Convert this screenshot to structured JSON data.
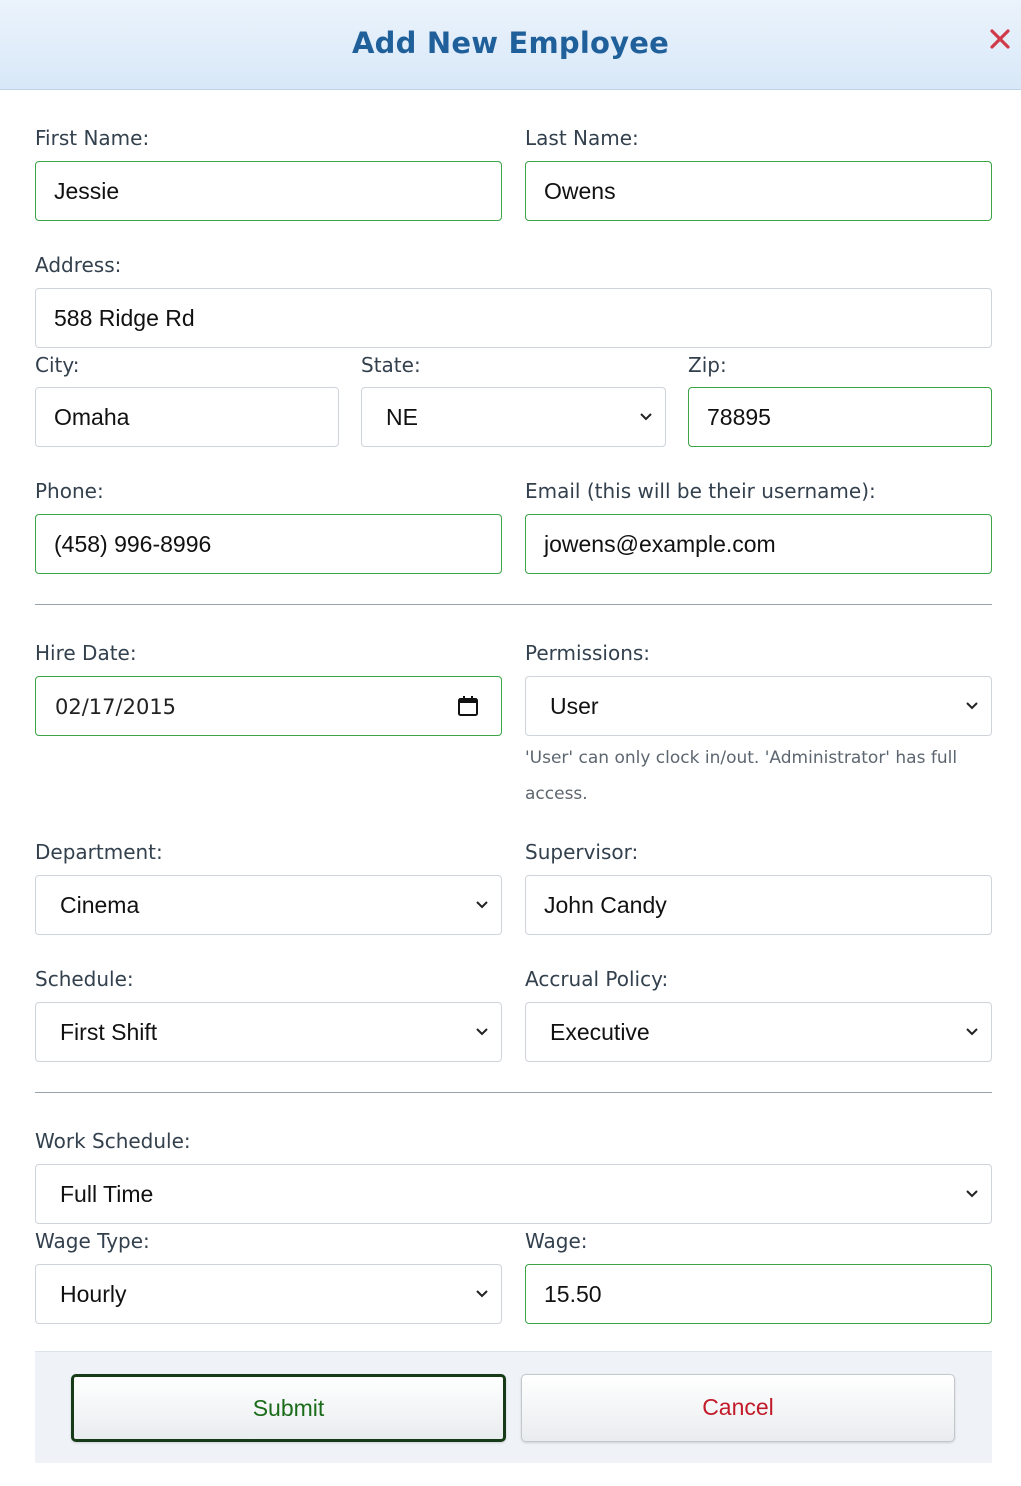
{
  "dialog": {
    "title": "Add New Employee",
    "close_icon": "close-icon",
    "accent_color": "#1f5f9a",
    "close_color": "#d03a4a"
  },
  "form": {
    "first_name": {
      "label": "First Name:",
      "value": "Jessie"
    },
    "last_name": {
      "label": "Last Name:",
      "value": "Owens"
    },
    "address": {
      "label": "Address:",
      "value": "588 Ridge Rd"
    },
    "city": {
      "label": "City:",
      "value": "Omaha"
    },
    "state": {
      "label": "State:",
      "value": "NE"
    },
    "zip": {
      "label": "Zip:",
      "value": "78895"
    },
    "phone": {
      "label": "Phone:",
      "value": "(458) 996-8996"
    },
    "email": {
      "label": "Email (this will be their username):",
      "value": "jowens@example.com"
    },
    "hire_date": {
      "label": "Hire Date:",
      "value": "02/17/2015"
    },
    "permissions": {
      "label": "Permissions:",
      "value": "User",
      "help": "'User' can only clock in/out. 'Administrator' has full access."
    },
    "department": {
      "label": "Department:",
      "value": "Cinema"
    },
    "supervisor": {
      "label": "Supervisor:",
      "value": "John Candy"
    },
    "schedule": {
      "label": "Schedule:",
      "value": "First Shift"
    },
    "accrual_policy": {
      "label": "Accrual Policy:",
      "value": "Executive"
    },
    "work_schedule": {
      "label": "Work Schedule:",
      "value": "Full Time"
    },
    "wage_type": {
      "label": "Wage Type:",
      "value": "Hourly"
    },
    "wage": {
      "label": "Wage:",
      "value": "15.50"
    }
  },
  "buttons": {
    "submit": "Submit",
    "cancel": "Cancel"
  },
  "colors": {
    "valid_border": "#3aa446",
    "submit_text": "#1a6b1a",
    "cancel_text": "#c21a2a"
  }
}
